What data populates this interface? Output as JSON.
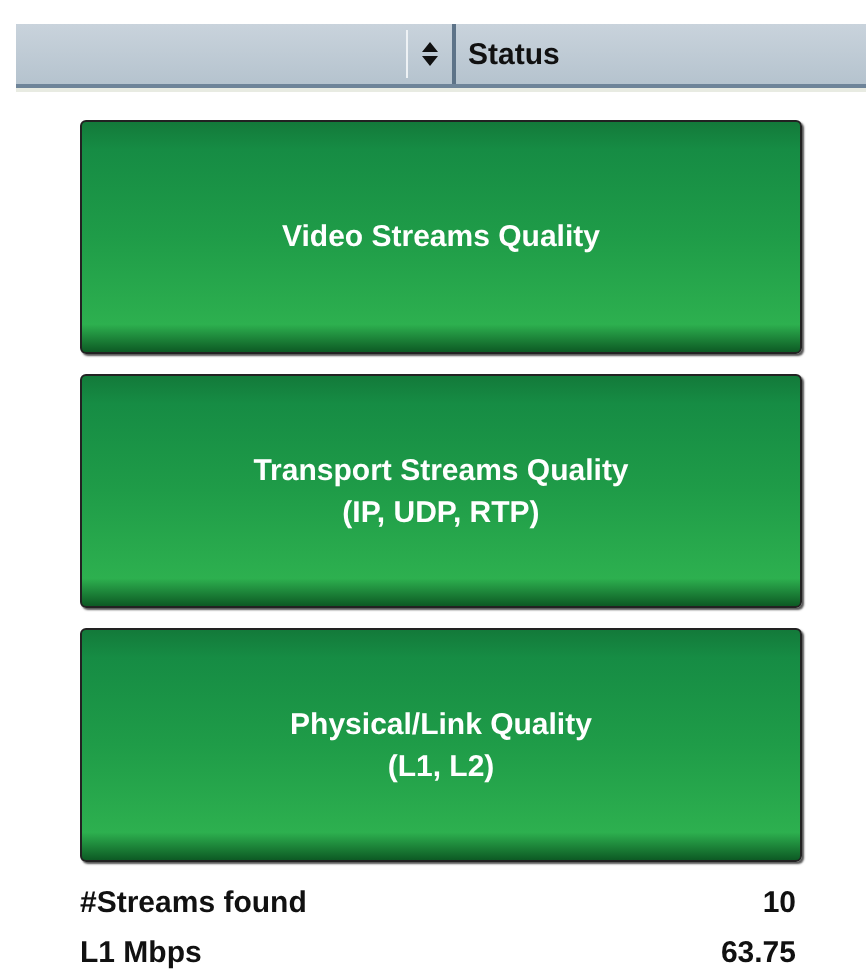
{
  "header": {
    "column_label": "Status"
  },
  "buttons": [
    {
      "lines": [
        "Video Streams Quality"
      ]
    },
    {
      "lines": [
        "Transport Streams Quality",
        "(IP, UDP, RTP)"
      ]
    },
    {
      "lines": [
        "Physical/Link Quality",
        "(L1, L2)"
      ]
    }
  ],
  "stats": [
    {
      "label": "#Streams found",
      "value": "10"
    },
    {
      "label": "L1 Mbps",
      "value": "63.75"
    }
  ]
}
